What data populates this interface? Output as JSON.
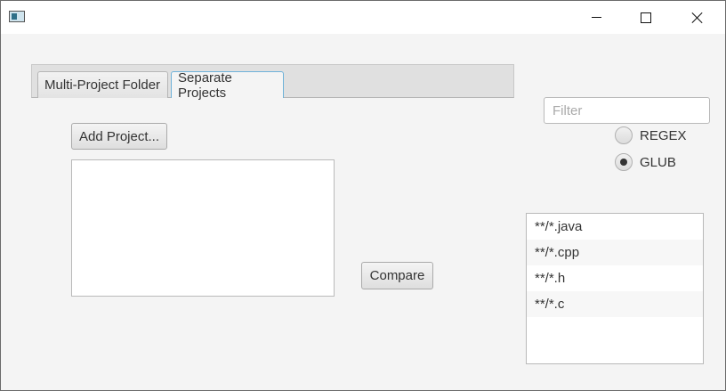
{
  "window": {
    "controls": {
      "minimize": "minimize",
      "maximize": "maximize",
      "close": "close"
    }
  },
  "tabs": [
    {
      "label": "Multi-Project Folder",
      "selected": false
    },
    {
      "label": "Separate Projects",
      "selected": true
    }
  ],
  "add_project_label": "Add Project...",
  "compare_label": "Compare",
  "filter": {
    "placeholder": "Filter",
    "value": ""
  },
  "mode_options": [
    {
      "label": "REGEX",
      "selected": false
    },
    {
      "label": "GLUB",
      "selected": true
    }
  ],
  "patterns": [
    "**/*.java",
    "**/*.cpp",
    "**/*.h",
    "**/*.c",
    ""
  ],
  "colors": {
    "tab_focus_border": "#6fb2d9",
    "window_bg": "#f4f4f4"
  }
}
